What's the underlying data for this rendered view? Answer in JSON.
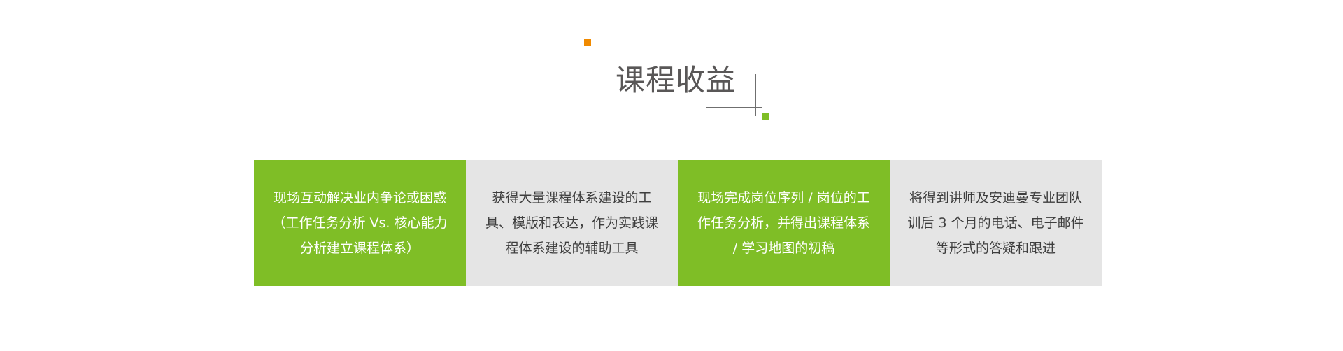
{
  "title": "课程收益",
  "colors": {
    "accent_green": "#7fbe26",
    "accent_orange": "#f08a00",
    "card_gray": "#e5e5e5",
    "title_gray": "#595757"
  },
  "cards": [
    {
      "text": "现场互动解决业内争论或困惑（工作任务分析 Vs. 核心能力分析建立课程体系）",
      "style": "green"
    },
    {
      "text": "获得大量课程体系建设的工具、模版和表达，作为实践课程体系建设的辅助工具",
      "style": "gray"
    },
    {
      "text": "现场完成岗位序列 / 岗位的工作任务分析，并得出课程体系 / 学习地图的初稿",
      "style": "green"
    },
    {
      "text": "将得到讲师及安迪曼专业团队训后 3 个月的电话、电子邮件等形式的答疑和跟进",
      "style": "gray"
    }
  ]
}
